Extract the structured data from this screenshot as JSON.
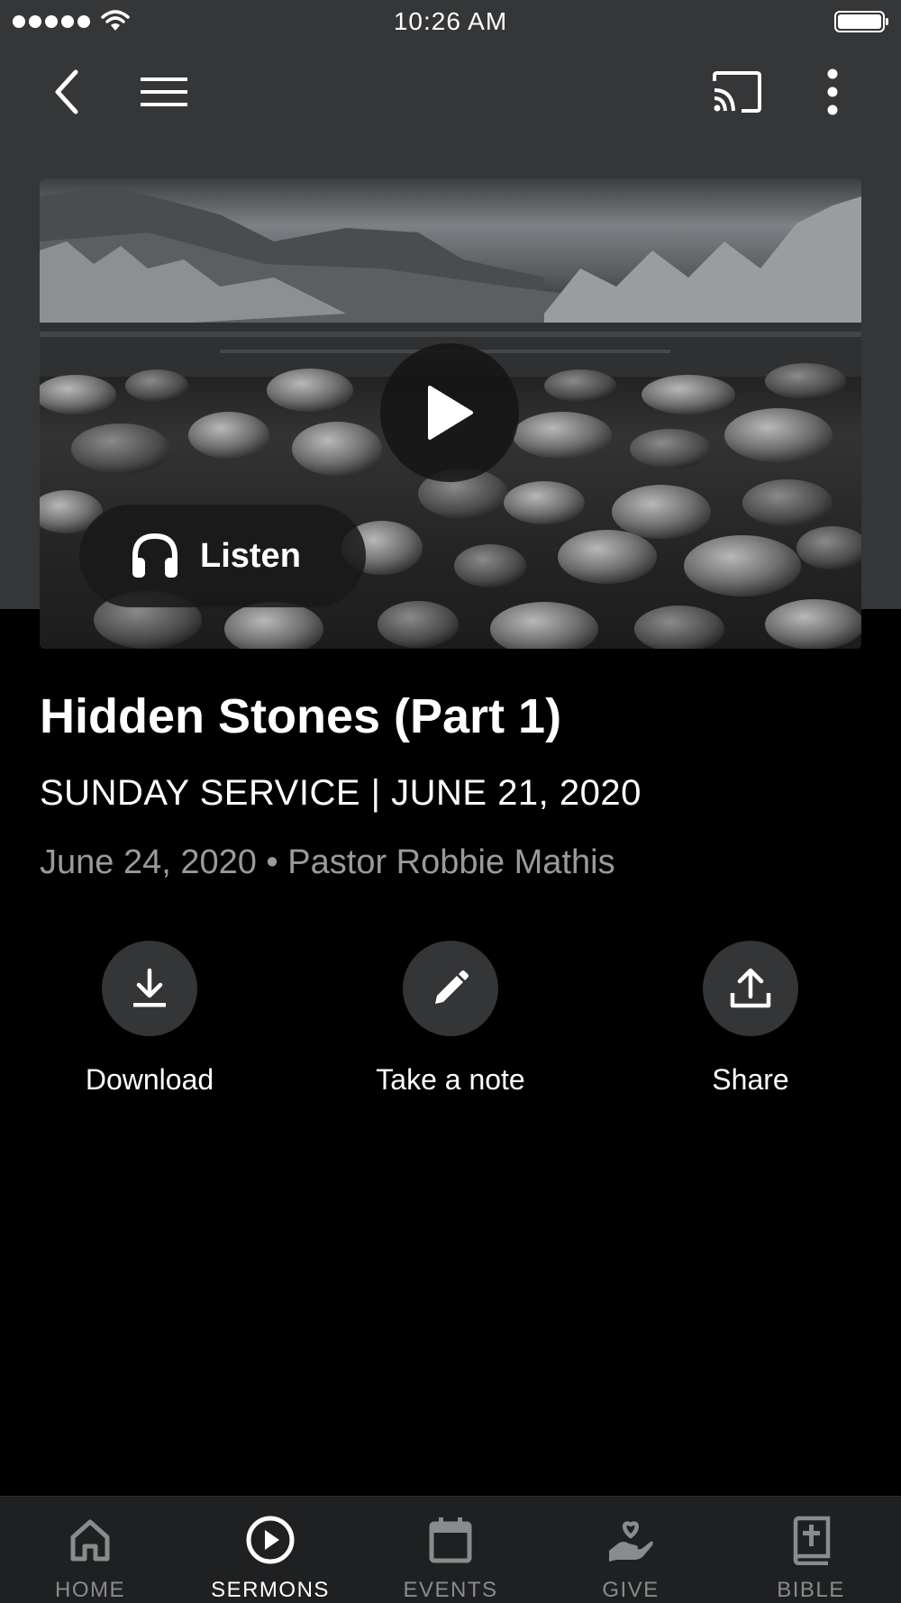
{
  "status_bar": {
    "time": "10:26 AM"
  },
  "toolbar": {
    "back_icon": "chevron-left-icon",
    "menu_icon": "hamburger-menu-icon",
    "cast_icon": "cast-icon",
    "more_icon": "more-vertical-icon"
  },
  "hero": {
    "play_icon": "play-icon",
    "listen_label": "Listen",
    "listen_icon": "headphones-icon"
  },
  "sermon": {
    "title": "Hidden Stones (Part 1)",
    "subtitle": "SUNDAY SERVICE | JUNE 21, 2020",
    "meta": "June 24, 2020 • Pastor Robbie Mathis"
  },
  "actions": [
    {
      "label": "Download",
      "icon": "download-icon"
    },
    {
      "label": "Take a note",
      "icon": "pencil-icon"
    },
    {
      "label": "Share",
      "icon": "share-icon"
    }
  ],
  "tabs": [
    {
      "label": "HOME",
      "icon": "home-icon",
      "active": false
    },
    {
      "label": "SERMONS",
      "icon": "play-circle-icon",
      "active": true
    },
    {
      "label": "EVENTS",
      "icon": "calendar-icon",
      "active": false
    },
    {
      "label": "GIVE",
      "icon": "give-hand-heart-icon",
      "active": false
    },
    {
      "label": "BIBLE",
      "icon": "bible-icon",
      "active": false
    }
  ]
}
